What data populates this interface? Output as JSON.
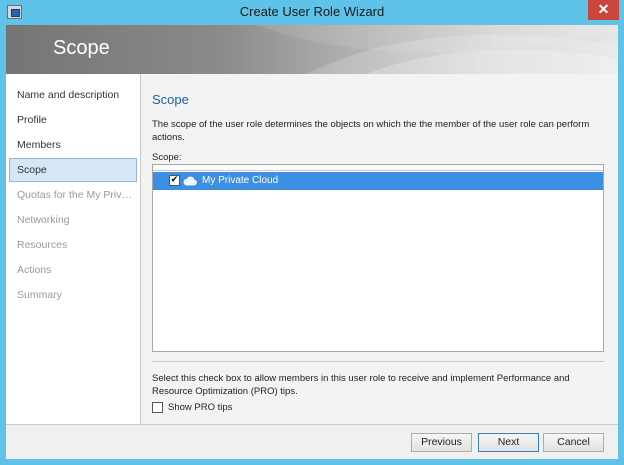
{
  "window": {
    "title": "Create User Role Wizard",
    "close_glyph": "✕"
  },
  "banner": {
    "title": "Scope"
  },
  "nav": {
    "items": [
      {
        "label": "Name and description",
        "state": "done"
      },
      {
        "label": "Profile",
        "state": "done"
      },
      {
        "label": "Members",
        "state": "done"
      },
      {
        "label": "Scope",
        "state": "selected"
      },
      {
        "label": "Quotas for the My Private...",
        "state": "disabled"
      },
      {
        "label": "Networking",
        "state": "disabled"
      },
      {
        "label": "Resources",
        "state": "disabled"
      },
      {
        "label": "Actions",
        "state": "disabled"
      },
      {
        "label": "Summary",
        "state": "disabled"
      }
    ]
  },
  "content": {
    "section_title": "Scope",
    "description": "The scope of the user role determines the objects on which the the member of the user role can perform actions.",
    "scope_label": "Scope:",
    "scope_items": [
      {
        "label": "My Private Cloud",
        "checked": true,
        "selected": true,
        "icon": "cloud-icon"
      }
    ],
    "pro_description": "Select this check box to allow members in this user role to receive and implement Performance and Resource Optimization (PRO) tips.",
    "pro_checkbox_label": "Show PRO tips",
    "pro_checked": false
  },
  "footer": {
    "previous_label": "Previous",
    "next_label": "Next",
    "cancel_label": "Cancel"
  },
  "colors": {
    "title_bar": "#5fc2e8",
    "close_button": "#c9463d",
    "selection": "#3c8fe3",
    "section_title": "#1e5fa8",
    "nav_selected": "#d5e6f6"
  }
}
